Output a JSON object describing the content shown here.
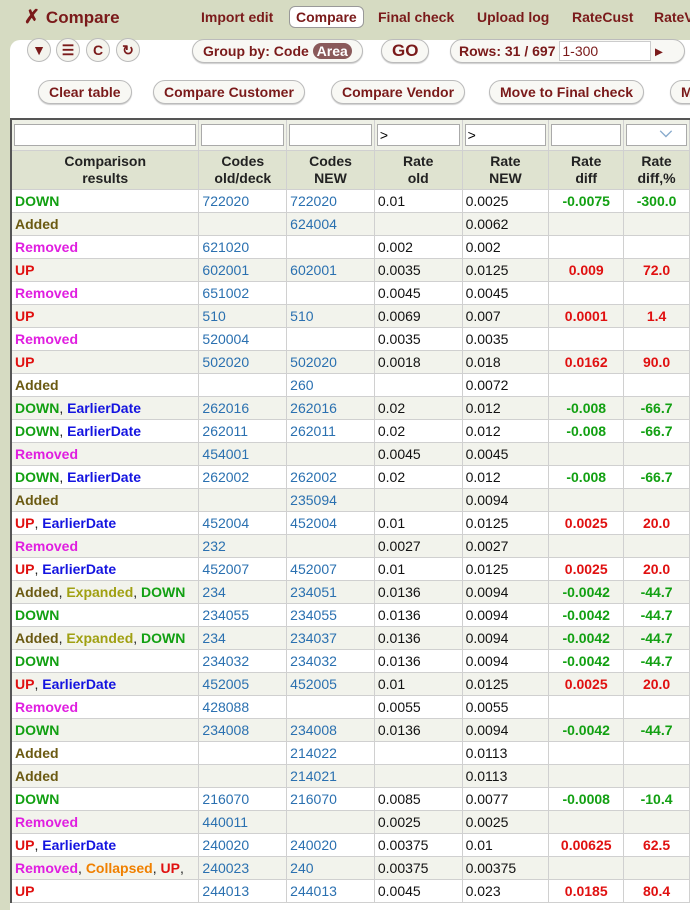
{
  "app": {
    "title": "Compare",
    "icon": "compare-x-icon"
  },
  "nav": [
    "Import edit",
    "Compare",
    "Final check",
    "Upload log",
    "RateCust",
    "RateV"
  ],
  "toolbar": {
    "group_by": "Group by:",
    "code": "Code",
    "area": "Area",
    "go": "GO",
    "rows_label": "Rows: 31 / 697",
    "range": "1-300"
  },
  "actions": [
    "Clear table",
    "Compare Customer",
    "Compare Vendor",
    "Move to Final check",
    "M"
  ],
  "filters": [
    "",
    "",
    "",
    "",
    ">",
    ">",
    "",
    ""
  ],
  "headers": [
    [
      "Comparison",
      "results"
    ],
    [
      "Codes",
      "old/deck"
    ],
    [
      "Codes",
      "NEW"
    ],
    [
      "Rate",
      "old"
    ],
    [
      "Rate",
      "NEW"
    ],
    [
      "Rate",
      "diff"
    ],
    [
      "Rate",
      "diff,%"
    ]
  ],
  "colors": {
    "DOWN": "#12a012",
    "Added": "#6b5a12",
    "Removed": "#e01ee0",
    "UP": "#e01010",
    "EarlierDate": "#1414e0",
    "Expanded": "#a0a012",
    "Collapsed": "#f08000",
    "positive": "#e01010",
    "negative": "#12a012"
  },
  "rows": [
    {
      "s": [
        "DOWN"
      ],
      "old": "722020",
      "new": "722020",
      "ro": "0.01",
      "rn": "0.0025",
      "d": "-0.0075",
      "p": "-300.0"
    },
    {
      "s": [
        "Added"
      ],
      "old": "",
      "new": "624004",
      "ro": "",
      "rn": "0.0062",
      "d": "",
      "p": ""
    },
    {
      "s": [
        "Removed"
      ],
      "old": "621020",
      "new": "",
      "ro": "0.002",
      "rn": "0.002",
      "d": "",
      "p": ""
    },
    {
      "s": [
        "UP"
      ],
      "old": "602001",
      "new": "602001",
      "ro": "0.0035",
      "rn": "0.0125",
      "d": "0.009",
      "p": "72.0"
    },
    {
      "s": [
        "Removed"
      ],
      "old": "651002",
      "new": "",
      "ro": "0.0045",
      "rn": "0.0045",
      "d": "",
      "p": ""
    },
    {
      "s": [
        "UP"
      ],
      "old": "510",
      "new": "510",
      "ro": "0.0069",
      "rn": "0.007",
      "d": "0.0001",
      "p": "1.4"
    },
    {
      "s": [
        "Removed"
      ],
      "old": "520004",
      "new": "",
      "ro": "0.0035",
      "rn": "0.0035",
      "d": "",
      "p": ""
    },
    {
      "s": [
        "UP"
      ],
      "old": "502020",
      "new": "502020",
      "ro": "0.0018",
      "rn": "0.018",
      "d": "0.0162",
      "p": "90.0"
    },
    {
      "s": [
        "Added"
      ],
      "old": "",
      "new": "260",
      "ro": "",
      "rn": "0.0072",
      "d": "",
      "p": ""
    },
    {
      "s": [
        "DOWN",
        "EarlierDate"
      ],
      "old": "262016",
      "new": "262016",
      "ro": "0.02",
      "rn": "0.012",
      "d": "-0.008",
      "p": "-66.7"
    },
    {
      "s": [
        "DOWN",
        "EarlierDate"
      ],
      "old": "262011",
      "new": "262011",
      "ro": "0.02",
      "rn": "0.012",
      "d": "-0.008",
      "p": "-66.7"
    },
    {
      "s": [
        "Removed"
      ],
      "old": "454001",
      "new": "",
      "ro": "0.0045",
      "rn": "0.0045",
      "d": "",
      "p": ""
    },
    {
      "s": [
        "DOWN",
        "EarlierDate"
      ],
      "old": "262002",
      "new": "262002",
      "ro": "0.02",
      "rn": "0.012",
      "d": "-0.008",
      "p": "-66.7"
    },
    {
      "s": [
        "Added"
      ],
      "old": "",
      "new": "235094",
      "ro": "",
      "rn": "0.0094",
      "d": "",
      "p": ""
    },
    {
      "s": [
        "UP",
        "EarlierDate"
      ],
      "old": "452004",
      "new": "452004",
      "ro": "0.01",
      "rn": "0.0125",
      "d": "0.0025",
      "p": "20.0"
    },
    {
      "s": [
        "Removed"
      ],
      "old": "232",
      "new": "",
      "ro": "0.0027",
      "rn": "0.0027",
      "d": "",
      "p": ""
    },
    {
      "s": [
        "UP",
        "EarlierDate"
      ],
      "old": "452007",
      "new": "452007",
      "ro": "0.01",
      "rn": "0.0125",
      "d": "0.0025",
      "p": "20.0"
    },
    {
      "s": [
        "Added",
        "Expanded",
        "DOWN"
      ],
      "old": "234",
      "new": "234051",
      "ro": "0.0136",
      "rn": "0.0094",
      "d": "-0.0042",
      "p": "-44.7"
    },
    {
      "s": [
        "DOWN"
      ],
      "old": "234055",
      "new": "234055",
      "ro": "0.0136",
      "rn": "0.0094",
      "d": "-0.0042",
      "p": "-44.7"
    },
    {
      "s": [
        "Added",
        "Expanded",
        "DOWN"
      ],
      "old": "234",
      "new": "234037",
      "ro": "0.0136",
      "rn": "0.0094",
      "d": "-0.0042",
      "p": "-44.7"
    },
    {
      "s": [
        "DOWN"
      ],
      "old": "234032",
      "new": "234032",
      "ro": "0.0136",
      "rn": "0.0094",
      "d": "-0.0042",
      "p": "-44.7"
    },
    {
      "s": [
        "UP",
        "EarlierDate"
      ],
      "old": "452005",
      "new": "452005",
      "ro": "0.01",
      "rn": "0.0125",
      "d": "0.0025",
      "p": "20.0"
    },
    {
      "s": [
        "Removed"
      ],
      "old": "428088",
      "new": "",
      "ro": "0.0055",
      "rn": "0.0055",
      "d": "",
      "p": ""
    },
    {
      "s": [
        "DOWN"
      ],
      "old": "234008",
      "new": "234008",
      "ro": "0.0136",
      "rn": "0.0094",
      "d": "-0.0042",
      "p": "-44.7"
    },
    {
      "s": [
        "Added"
      ],
      "old": "",
      "new": "214022",
      "ro": "",
      "rn": "0.0113",
      "d": "",
      "p": ""
    },
    {
      "s": [
        "Added"
      ],
      "old": "",
      "new": "214021",
      "ro": "",
      "rn": "0.0113",
      "d": "",
      "p": ""
    },
    {
      "s": [
        "DOWN"
      ],
      "old": "216070",
      "new": "216070",
      "ro": "0.0085",
      "rn": "0.0077",
      "d": "-0.0008",
      "p": "-10.4"
    },
    {
      "s": [
        "Removed"
      ],
      "old": "440011",
      "new": "",
      "ro": "0.0025",
      "rn": "0.0025",
      "d": "",
      "p": ""
    },
    {
      "s": [
        "UP",
        "EarlierDate"
      ],
      "old": "240020",
      "new": "240020",
      "ro": "0.00375",
      "rn": "0.01",
      "d": "0.00625",
      "p": "62.5"
    },
    {
      "s": [
        "Removed",
        "Collapsed",
        "UP",
        ""
      ],
      "old": "240023",
      "new": "240",
      "ro": "0.00375",
      "rn": "0.00375",
      "d": "",
      "p": ""
    },
    {
      "s": [
        "UP"
      ],
      "old": "244013",
      "new": "244013",
      "ro": "0.0045",
      "rn": "0.023",
      "d": "0.0185",
      "p": "80.4"
    }
  ]
}
